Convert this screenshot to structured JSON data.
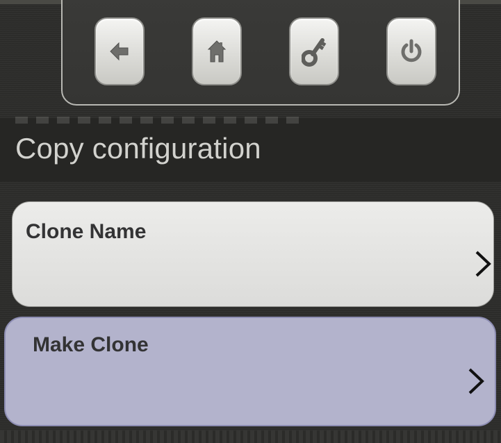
{
  "toolbar": {
    "buttons": [
      {
        "id": "back",
        "icon": "back-arrow-icon"
      },
      {
        "id": "home",
        "icon": "home-icon"
      },
      {
        "id": "key",
        "icon": "key-icon"
      },
      {
        "id": "power",
        "icon": "power-icon"
      }
    ]
  },
  "page": {
    "title": "Copy configuration"
  },
  "menu": {
    "items": [
      {
        "label": "Clone Name",
        "icon": "chevron-right-icon",
        "color": "#e4e4e2"
      },
      {
        "label": "Make Clone",
        "icon": "chevron-right-icon",
        "color": "#b3b3cc"
      }
    ]
  },
  "colors": {
    "background": "#2c2c2a",
    "title_text": "#d2d2ce",
    "label_text": "#333334"
  }
}
